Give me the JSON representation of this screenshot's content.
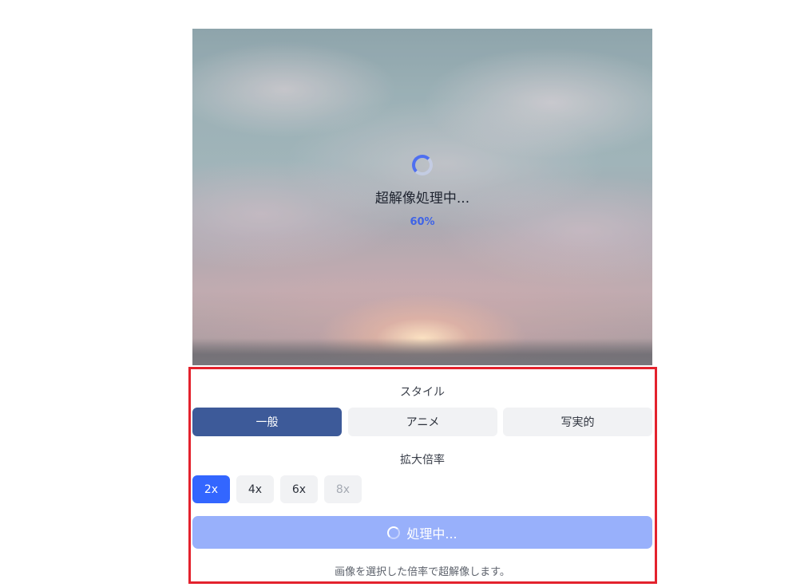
{
  "preview": {
    "status_text": "超解像処理中...",
    "progress_text": "60%",
    "progress": 0.6
  },
  "style": {
    "label": "スタイル",
    "options": [
      {
        "label": "一般",
        "selected": true
      },
      {
        "label": "アニメ",
        "selected": false
      },
      {
        "label": "写実的",
        "selected": false
      }
    ]
  },
  "scale": {
    "label": "拡大倍率",
    "options": [
      {
        "label": "2x",
        "selected": true,
        "disabled": false
      },
      {
        "label": "4x",
        "selected": false,
        "disabled": false
      },
      {
        "label": "6x",
        "selected": false,
        "disabled": false
      },
      {
        "label": "8x",
        "selected": false,
        "disabled": true
      }
    ]
  },
  "action": {
    "label": "処理中..."
  },
  "hint": "画像を選択した倍率で超解像します。",
  "colors": {
    "accent": "#3366ff",
    "style_selected": "#3d5a99",
    "button_processing": "#98b0fb",
    "highlight_frame": "#e3222d"
  },
  "icons": {
    "loading": "spinner-icon",
    "button_loading": "spinner-icon"
  }
}
